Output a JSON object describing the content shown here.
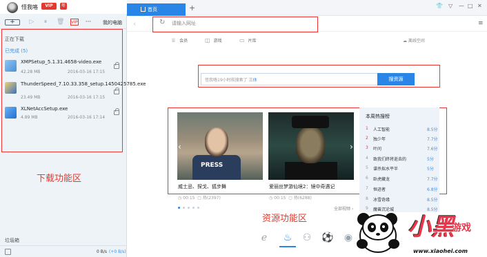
{
  "user": {
    "name": "怪我咯",
    "vip_badge": "VIP",
    "year_badge": "年"
  },
  "toolbar": {
    "new_task": "+",
    "my_pc": "我的电脑",
    "more": "···"
  },
  "downloads": {
    "downloading_label": "正在下载",
    "completed_label": "已完成 (5)",
    "items": [
      {
        "name": "XMPSetup_5.1.31.4658-video.exe",
        "size": "42.28 MB",
        "date": "2016-03-16 17:15",
        "icon_color": "#4a90d9"
      },
      {
        "name": "ThunderSpeed_7.10.33.358_setup.1450425785.exe",
        "size": "23.49 MB",
        "date": "2016-03-16 17:15",
        "icon_color": "#e8b13a"
      },
      {
        "name": "XLNetAccSetup.exe",
        "size": "4.89 MB",
        "date": "2016-03-16 17:14",
        "icon_color": "#2a86e6"
      }
    ],
    "zone_label": "下载功能区",
    "recycle_label": "垃圾箱",
    "speed": "0 B/s",
    "speed_up": "(+0 B/s)"
  },
  "browser": {
    "home_tab": "首页",
    "new_tab": "+",
    "address_placeholder": "请输入网址",
    "quick_links": [
      "会员",
      "游戏",
      "片库"
    ],
    "net_speed": "离线空间",
    "search_hint_prefix": "怪我咯19小时前搜索了",
    "search_hint_term": "三体",
    "search_button": "搜资源"
  },
  "resources": {
    "cards": [
      {
        "title": "威士忌、探戈、狐步舞",
        "duration": "00:15",
        "views": "热(2397)"
      },
      {
        "title": "爱丽丝梦游仙境2：镜中奇遇记",
        "duration": "00:15",
        "views": "热(6288)"
      }
    ],
    "all_videos": "全部视频 ›",
    "zone_label": "资源功能区"
  },
  "hot_list": {
    "title": "本周热搜榜",
    "items": [
      {
        "rank": "1",
        "name": "人工智能",
        "score": "8.5分"
      },
      {
        "rank": "2",
        "name": "独少年",
        "score": "7.7分"
      },
      {
        "rank": "3",
        "name": "叶问",
        "score": "7.6分"
      },
      {
        "rank": "4",
        "name": "致我们终将逝去的",
        "score": "5分"
      },
      {
        "rank": "5",
        "name": "谍杀拟水平半",
        "score": "5分"
      },
      {
        "rank": "6",
        "name": "卧虎藏龙",
        "score": "7.7分"
      },
      {
        "rank": "7",
        "name": "恒迹者",
        "score": "6.8分"
      },
      {
        "rank": "8",
        "name": "冰雪奇缘",
        "score": "8.5分"
      },
      {
        "rank": "9",
        "name": "魔兽沉沦城",
        "score": "8.5分"
      }
    ]
  },
  "watermark": {
    "text": "小黑",
    "text2": "游戏",
    "url": "www.xiaohei.com"
  }
}
